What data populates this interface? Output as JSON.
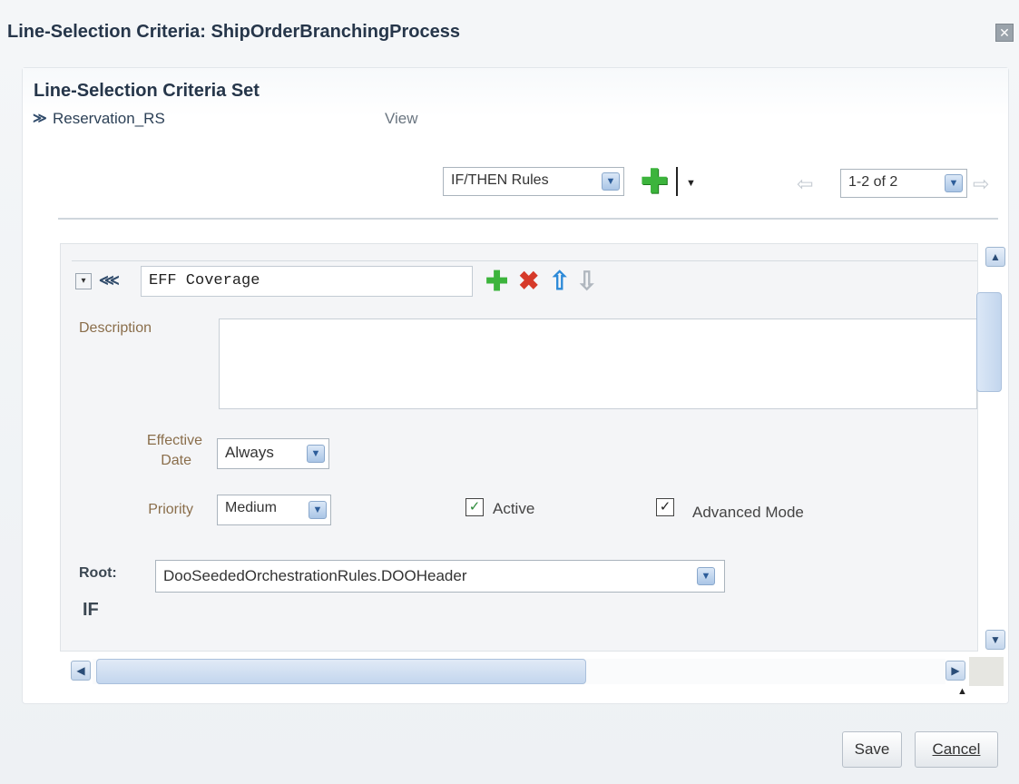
{
  "dialog": {
    "title": "Line-Selection Criteria: ShipOrderBranchingProcess",
    "close_glyph": "✕"
  },
  "panel": {
    "title": "Line-Selection Criteria Set"
  },
  "ruleset": {
    "name": "Reservation_RS",
    "view_label": "View",
    "view_value": "IF/THEN Rules",
    "pager_value": "1-2 of 2"
  },
  "rule": {
    "name": "EFF Coverage",
    "description_label": "Description",
    "description_value": "",
    "effective_date_label_1": "Effective",
    "effective_date_label_2": "Date",
    "effective_date_value": "Always",
    "priority_label": "Priority",
    "priority_value": "Medium",
    "active_label": "Active",
    "active_checked": true,
    "advanced_label": "Advanced Mode",
    "advanced_checked": true,
    "root_label": "Root:",
    "root_value": "DooSeededOrchestrationRules.DOOHeader",
    "if_label": "IF"
  },
  "footer": {
    "save_label": "Save",
    "cancel_label": "Cancel"
  },
  "icons": {
    "add": "green-plus-icon",
    "delete": "red-x-icon",
    "move_up": "blue-up-arrow-icon",
    "move_down": "gray-down-arrow-icon"
  },
  "colors": {
    "title": "#26364a",
    "label_brown": "#8a6e4b",
    "add_green": "#3cb43c",
    "delete_red": "#d63a2a",
    "up_blue": "#2d8ad8"
  }
}
